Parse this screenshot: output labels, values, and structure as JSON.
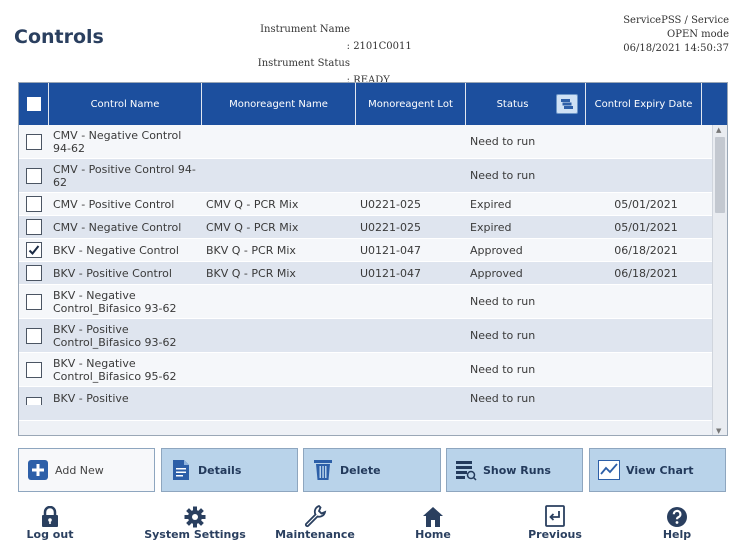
{
  "header": {
    "title": "Controls",
    "instrument_name_label": "Instrument Name :",
    "instrument_name_value": "2101C0011",
    "instrument_status_label": "Instrument Status :",
    "instrument_status_value": "READY",
    "user": "ServicePSS / Service",
    "mode": "OPEN mode",
    "datetime": "06/18/2021 14:50:37"
  },
  "table": {
    "columns": [
      "Control Name",
      "Monoreagent Name",
      "Monoreagent Lot",
      "Status",
      "Control Expiry Date"
    ],
    "rows": [
      {
        "checked": false,
        "name": "CMV - Negative Control 94-62",
        "mono": "",
        "lot": "",
        "status": "Need to run",
        "expiry": ""
      },
      {
        "checked": false,
        "name": "CMV - Positive Control 94-62",
        "mono": "",
        "lot": "",
        "status": "Need to run",
        "expiry": ""
      },
      {
        "checked": false,
        "name": "CMV - Positive Control",
        "mono": "CMV Q - PCR Mix",
        "lot": "U0221-025",
        "status": "Expired",
        "expiry": "05/01/2021"
      },
      {
        "checked": false,
        "name": "CMV - Negative Control",
        "mono": "CMV Q - PCR Mix",
        "lot": "U0221-025",
        "status": "Expired",
        "expiry": "05/01/2021"
      },
      {
        "checked": true,
        "name": "BKV - Negative Control",
        "mono": "BKV Q - PCR Mix",
        "lot": "U0121-047",
        "status": "Approved",
        "expiry": "06/18/2021"
      },
      {
        "checked": false,
        "name": "BKV - Positive Control",
        "mono": "BKV Q - PCR Mix",
        "lot": "U0121-047",
        "status": "Approved",
        "expiry": "06/18/2021"
      },
      {
        "checked": false,
        "name": "BKV - Negative Control_Bifasico 93-62",
        "mono": "",
        "lot": "",
        "status": "Need to run",
        "expiry": ""
      },
      {
        "checked": false,
        "name": "BKV - Positive Control_Bifasico 93-62",
        "mono": "",
        "lot": "",
        "status": "Need to run",
        "expiry": ""
      },
      {
        "checked": false,
        "name": "BKV - Negative Control_Bifasico 95-62",
        "mono": "",
        "lot": "",
        "status": "Need to run",
        "expiry": ""
      },
      {
        "checked": false,
        "name": "BKV - Positive",
        "mono": "",
        "lot": "",
        "status": "Need to run",
        "expiry": ""
      }
    ]
  },
  "actions": {
    "add_new": "Add New",
    "details": "Details",
    "delete": "Delete",
    "show_runs": "Show Runs",
    "view_chart": "View Chart"
  },
  "nav": {
    "log_out": "Log out",
    "system_settings": "System Settings",
    "maintenance": "Maintenance",
    "home": "Home",
    "previous": "Previous",
    "help": "Help"
  },
  "colors": {
    "header_bg": "#1c4f9e",
    "row_alt": "#dfe5ef",
    "button_bg": "#b9d3ea",
    "title": "#2a3f5f"
  }
}
